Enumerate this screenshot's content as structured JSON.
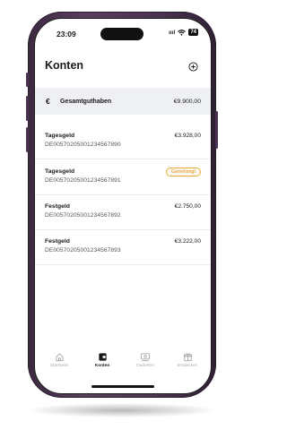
{
  "status_bar": {
    "time": "23:09",
    "signal": "ıııl",
    "wifi": "wifi",
    "battery": "74"
  },
  "header": {
    "title": "Konten",
    "add_icon": "plus-circle-icon"
  },
  "total": {
    "icon": "€",
    "label": "Gesamtguthaben",
    "value": "€9.900,00"
  },
  "accounts": [
    {
      "name": "Tagesgeld",
      "iban": "DE00570205001234567890",
      "amount": "€3.928,00"
    },
    {
      "name": "Tagesgeld",
      "iban": "DE00570205001234567891",
      "status": "Genehmigt"
    },
    {
      "name": "Festgeld",
      "iban": "DE00570205001234567892",
      "amount": "€2.750,00"
    },
    {
      "name": "Festgeld",
      "iban": "DE00570205001234567893",
      "amount": "€3.222,00"
    }
  ],
  "tabbar": {
    "active": "Konten",
    "tabs": [
      {
        "label": "Startseite",
        "icon": "home-icon"
      },
      {
        "label": "Konten",
        "icon": "wallet-icon"
      },
      {
        "label": "Darlehen",
        "icon": "loan-icon"
      },
      {
        "label": "Entdecken",
        "icon": "gift-icon"
      }
    ]
  },
  "colors": {
    "accent_badge": "#e8a935",
    "frame": "#4a3350",
    "highlight_row": "#eef0f4"
  }
}
